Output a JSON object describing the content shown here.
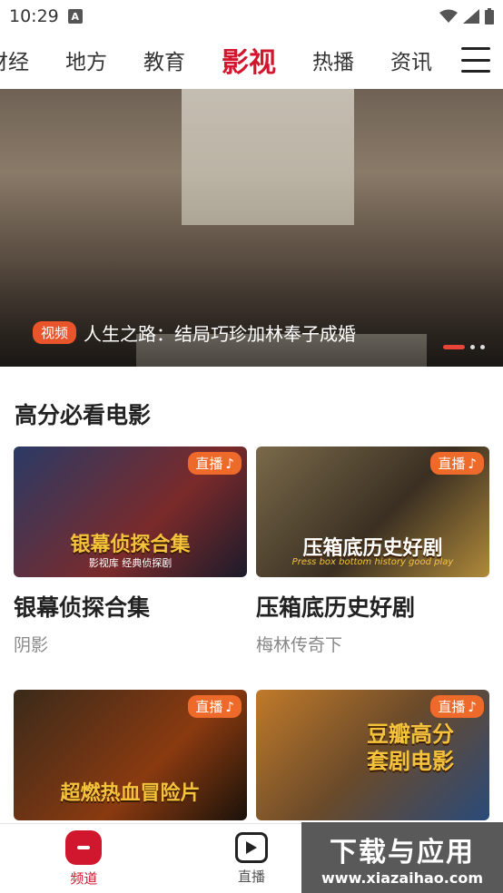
{
  "status": {
    "time": "10:29"
  },
  "nav": {
    "tabs": [
      "财经",
      "地方",
      "教育",
      "影视",
      "热播",
      "资讯"
    ],
    "active": "影视"
  },
  "hero": {
    "badge": "视频",
    "title": "人生之路：结局巧珍加林奉子成婚"
  },
  "section": {
    "title": "高分必看电影"
  },
  "cards": [
    {
      "thumb_text": "银幕侦探合集",
      "thumb_sub": "影视库 经典侦探剧",
      "live": "直播",
      "title": "银幕侦探合集",
      "subtitle": "阴影"
    },
    {
      "thumb_text": "压箱底历史好剧",
      "thumb_sub": "Press box bottom history good play",
      "live": "直播",
      "title": "压箱底历史好剧",
      "subtitle": "梅林传奇下"
    },
    {
      "thumb_text": "超燃热血冒险片",
      "live": "直播"
    },
    {
      "thumb_text": "豆瓣高分套剧电影",
      "live": "直播"
    }
  ],
  "tabbar": {
    "items": [
      "频道",
      "直播"
    ]
  },
  "watermark": {
    "cn": "下载与应用",
    "url": "www.xiazaihao.com"
  }
}
